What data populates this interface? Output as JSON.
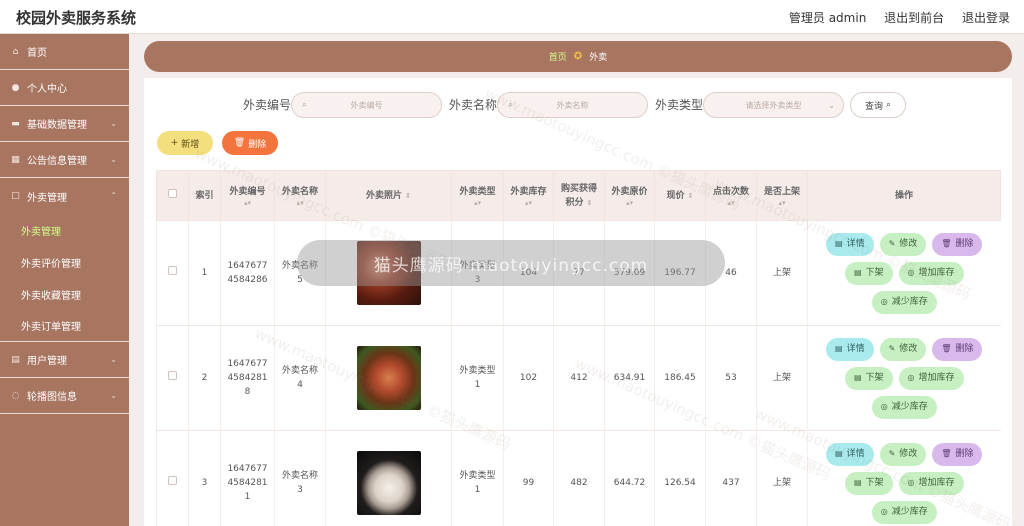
{
  "header": {
    "title": "校园外卖服务系统",
    "admin_label": "管理员 admin",
    "to_front_label": "退出到前台",
    "logout_label": "退出登录"
  },
  "sidebar": {
    "items": [
      {
        "label": "首页",
        "icon": "home-icon"
      },
      {
        "label": "个人中心",
        "icon": "user-icon"
      },
      {
        "label": "基础数据管理",
        "icon": "briefcase-icon"
      },
      {
        "label": "公告信息管理",
        "icon": "grid-icon"
      },
      {
        "label": "外卖管理",
        "icon": "box-icon"
      }
    ],
    "sub_items": [
      {
        "label": "外卖管理",
        "active": true
      },
      {
        "label": "外卖评价管理"
      },
      {
        "label": "外卖收藏管理"
      },
      {
        "label": "外卖订单管理"
      }
    ],
    "bottom_items": [
      {
        "label": "用户管理",
        "icon": "users-icon"
      },
      {
        "label": "轮播图信息",
        "icon": "image-icon"
      }
    ]
  },
  "breadcrumb": {
    "home": "首页",
    "current": "外卖"
  },
  "search": {
    "code_label": "外卖编号",
    "code_placeholder": "外卖编号",
    "name_label": "外卖名称",
    "name_placeholder": "外卖名称",
    "type_label": "外卖类型",
    "type_placeholder": "请选择外卖类型",
    "query_label": "查询"
  },
  "actions": {
    "add_label": "新增",
    "delete_label": "删除"
  },
  "table": {
    "headers": {
      "index": "索引",
      "code": "外卖编号",
      "name": "外卖名称",
      "photo": "外卖照片",
      "type": "外卖类型",
      "stock": "外卖库存",
      "points_1": "购买获得",
      "points_2": "积分",
      "orig_price": "外卖原价",
      "price": "现价",
      "clicks": "点击次数",
      "listed": "是否上架",
      "ops": "操作"
    },
    "rows": [
      {
        "index": "1",
        "code": "1647677\n4584286",
        "name": "外卖名称\n5",
        "type": "外卖类型\n3",
        "stock": "104",
        "points": "77",
        "orig_price": "579.09",
        "price": "196.77",
        "clicks": "46",
        "listed": "上架"
      },
      {
        "index": "2",
        "code": "1647677\n4584281\n8",
        "name": "外卖名称\n4",
        "type": "外卖类型\n1",
        "stock": "102",
        "points": "412",
        "orig_price": "634.91",
        "price": "186.45",
        "clicks": "53",
        "listed": "上架"
      },
      {
        "index": "3",
        "code": "1647677\n4584281\n1",
        "name": "外卖名称\n3",
        "type": "外卖类型\n1",
        "stock": "99",
        "points": "482",
        "orig_price": "644.72",
        "price": "126.54",
        "clicks": "437",
        "listed": "上架"
      }
    ],
    "op_labels": {
      "detail": "详情",
      "edit": "修改",
      "delete": "删除",
      "unlist": "下架",
      "add_stock": "增加库存",
      "reduce_stock": "减少库存"
    }
  },
  "overlay": {
    "loading_text": "猫头鹰源码 maotouyingcc.com",
    "watermark_text": "www.maotouyingcc.com ©猫头鹰源码"
  },
  "colors": {
    "sidebar": "#a87561",
    "active_sub": "#d3ff8a",
    "add_button": "#f3df7e",
    "delete_button": "#f4743d"
  }
}
